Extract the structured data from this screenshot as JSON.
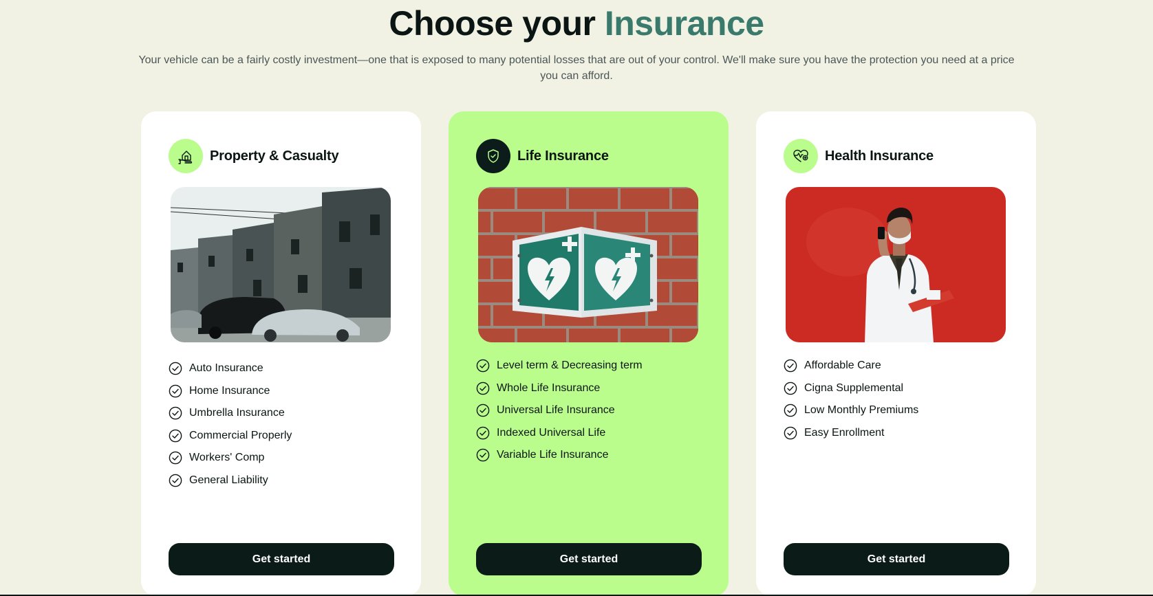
{
  "hero": {
    "title_main": "Choose your ",
    "title_accent": "Insurance",
    "subtitle": "Your vehicle can be a fairly costly investment—one that is exposed to many potential losses that are out of your control. We'll make sure you have the protection you need at a price you can afford."
  },
  "cards": [
    {
      "title": "Property & Casualty",
      "icon": "house-hand-icon",
      "features": [
        "Auto Insurance",
        "Home Insurance",
        "Umbrella Insurance",
        "Commercial Properly",
        "Workers' Comp",
        "General Liability"
      ],
      "cta": "Get started"
    },
    {
      "title": "Life Insurance",
      "icon": "shield-check-icon",
      "features": [
        "Level term & Decreasing term",
        "Whole Life Insurance",
        "Universal Life Insurance",
        "Indexed Universal Life",
        "Variable Life Insurance"
      ],
      "cta": "Get started"
    },
    {
      "title": "Health Insurance",
      "icon": "heartbeat-icon",
      "features": [
        "Affordable Care",
        "Cigna Supplemental",
        "Low Monthly Premiums",
        "Easy Enrollment"
      ],
      "cta": "Get started"
    }
  ],
  "colors": {
    "background": "#f1f2e4",
    "accent": "#3a7a6c",
    "lime": "#bbfd8c",
    "dark": "#0a1b18"
  }
}
